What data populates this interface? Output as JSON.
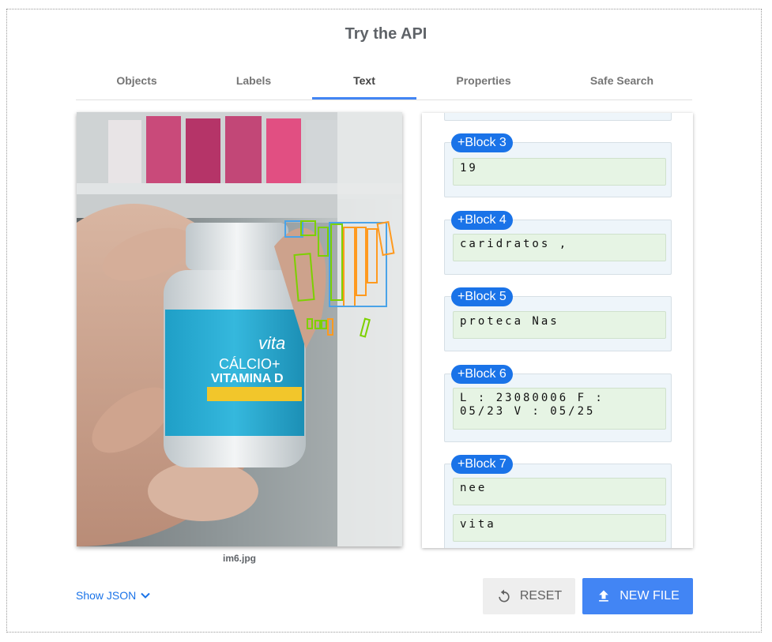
{
  "title": "Try the API",
  "tabs": [
    {
      "label": "Objects"
    },
    {
      "label": "Labels"
    },
    {
      "label": "Text",
      "active": true
    },
    {
      "label": "Properties"
    },
    {
      "label": "Safe Search"
    }
  ],
  "image": {
    "filename": "im6.jpg"
  },
  "blocks": [
    {
      "label": "+Block 3",
      "lines": [
        "19"
      ]
    },
    {
      "label": "+Block 4",
      "lines": [
        "caridratos ,"
      ]
    },
    {
      "label": "+Block 5",
      "lines": [
        "proteca Nas"
      ]
    },
    {
      "label": "+Block 6",
      "lines": [
        "L : 23080006 F : 05/23 V : 05/25"
      ]
    },
    {
      "label": "+Block 7",
      "lines": [
        "nee",
        "vita"
      ]
    }
  ],
  "footer": {
    "show_json_label": "Show JSON",
    "reset_label": "RESET",
    "new_file_label": "NEW FILE"
  },
  "colors": {
    "accent": "#4285f4",
    "pill": "#1a73e8",
    "block_bg": "#eef5fa",
    "line_bg": "#e6f4e4"
  },
  "icons": {
    "show_json": "chevron-down-icon",
    "reset": "reset-icon",
    "new_file": "upload-icon"
  }
}
